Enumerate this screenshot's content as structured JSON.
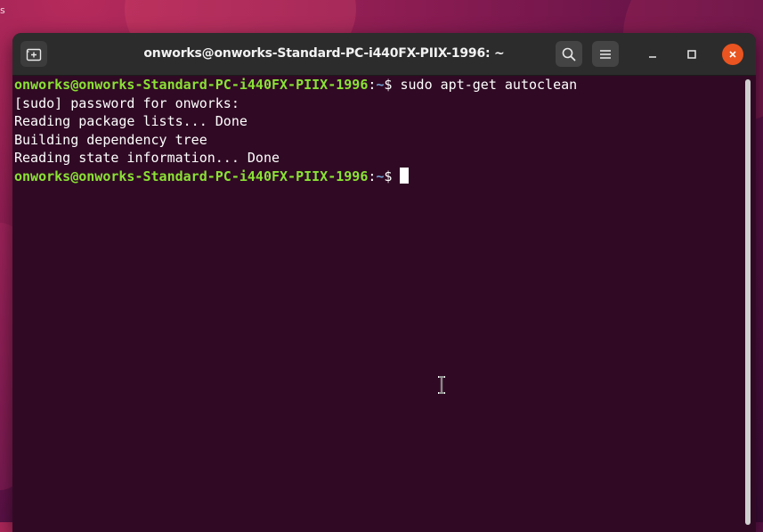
{
  "window": {
    "title": "onworks@onworks-Standard-PC-i440FX-PIIX-1996: ~"
  },
  "header_buttons": {
    "new_tab_icon": "new-tab-icon",
    "search_icon": "search-icon",
    "menu_icon": "hamburger-menu-icon",
    "minimize_icon": "minimize-icon",
    "maximize_icon": "maximize-icon",
    "close_icon": "close-icon"
  },
  "terminal": {
    "lines": [
      {
        "prompt": "onworks@onworks-Standard-PC-i440FX-PIIX-1996",
        "sep": ":",
        "path": "~",
        "symbol": "$ ",
        "command": "sudo apt-get autoclean"
      },
      {
        "text": "[sudo] password for onworks:"
      },
      {
        "text": "Reading package lists... Done"
      },
      {
        "text": "Building dependency tree"
      },
      {
        "text": "Reading state information... Done"
      },
      {
        "prompt": "onworks@onworks-Standard-PC-i440FX-PIIX-1996",
        "sep": ":",
        "path": "~",
        "symbol": "$ ",
        "command": ""
      }
    ]
  },
  "colors": {
    "terminal_bg": "#300a24",
    "prompt_green": "#8ae234",
    "path_blue": "#729fcf",
    "close_orange": "#e95420",
    "headerbar": "#2c2c2c"
  }
}
